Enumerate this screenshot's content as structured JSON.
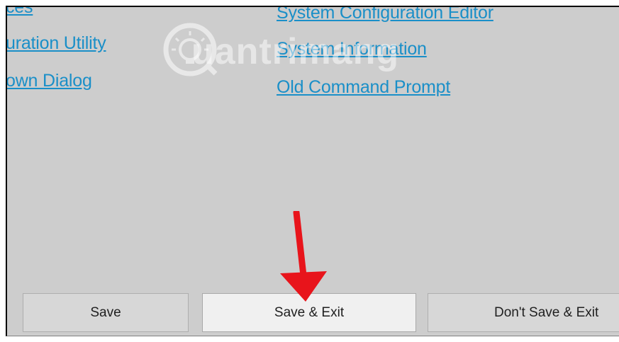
{
  "links": {
    "top_left_partial": "ces",
    "configuration_utility": "uration Utility",
    "shutdown_dialog": "own Dialog",
    "system_configuration_editor": "System Configuration Editor",
    "system_information": "System Information",
    "old_command_prompt": "Old Command Prompt"
  },
  "buttons": {
    "save": "Save",
    "save_exit": "Save & Exit",
    "dont_save_exit": "Don't Save & Exit"
  },
  "watermark": {
    "text": "uantrimang",
    "icon": "lightbulb-icon"
  },
  "annotation": {
    "icon": "red-arrow-icon",
    "color": "#e8141b"
  },
  "colors": {
    "link": "#1a8fc8",
    "background": "#cdcdcd",
    "button_primary": "#f0f0f0",
    "button": "#d7d7d7"
  }
}
